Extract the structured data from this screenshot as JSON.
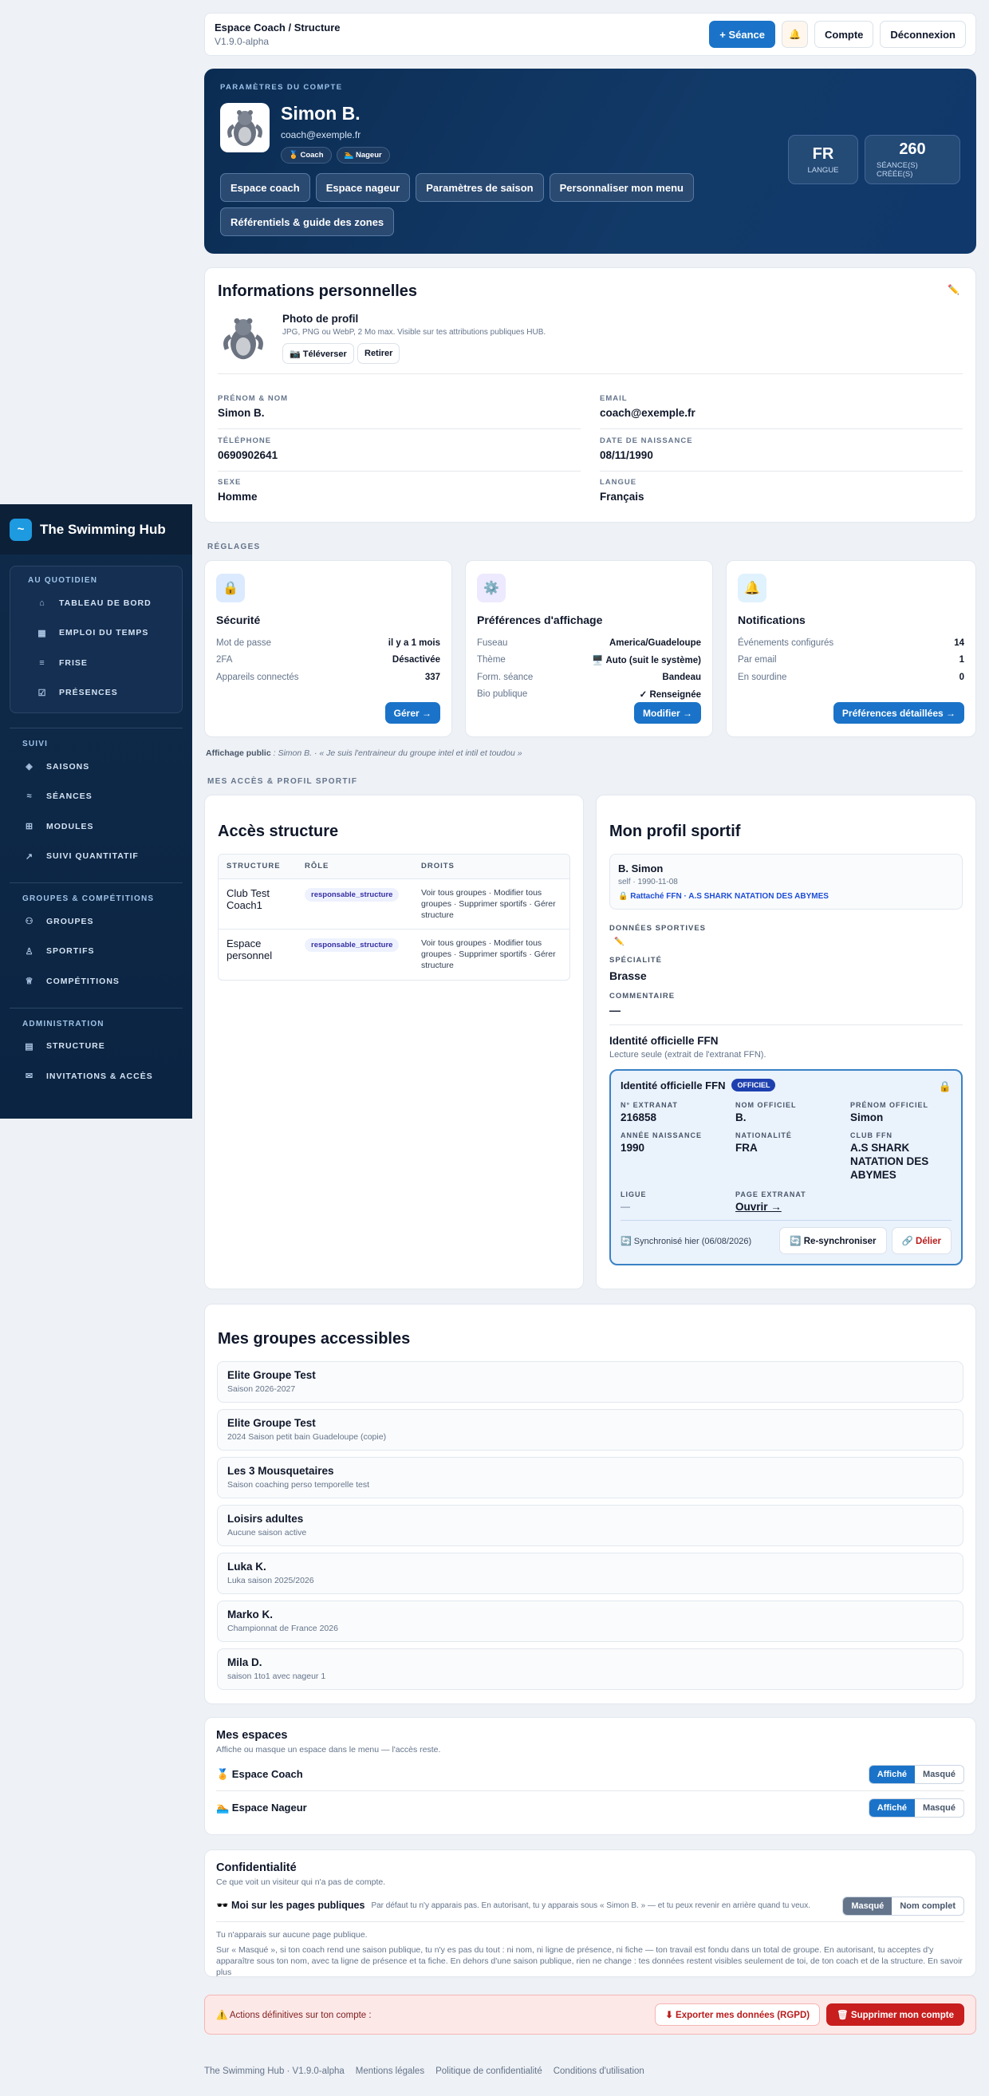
{
  "sidebar": {
    "brand": "The Swimming Hub",
    "daily_section": "AU QUOTIDIEN",
    "daily_items": [
      "TABLEAU DE BORD",
      "EMPLOI DU TEMPS",
      "FRISE",
      "PRÉSENCES"
    ],
    "follow_section": "SUIVI",
    "follow_items": [
      "SAISONS",
      "SÉANCES",
      "MODULES",
      "SUIVI QUANTITATIF"
    ],
    "groups_section": "GROUPES & COMPÉTITIONS",
    "groups_items": [
      "GROUPES",
      "SPORTIFS",
      "COMPÉTITIONS"
    ],
    "admin_section": "ADMINISTRATION",
    "admin_items": [
      "STRUCTURE",
      "INVITATIONS & ACCÈS"
    ]
  },
  "topbar": {
    "title": "Espace Coach / Structure",
    "version": "V1.9.0-alpha",
    "new_session": "+ Séance",
    "bell": "🔔",
    "account": "Compte",
    "logout": "Déconnexion"
  },
  "hero": {
    "kicker": "PARAMÈTRES DU COMPTE",
    "name": "Simon B.",
    "email": "coach@exemple.fr",
    "badge_coach": "🏅 Coach",
    "badge_swimmer": "🏊 Nageur",
    "buttons": [
      "Espace coach",
      "Espace nageur",
      "Paramètres de saison",
      "Personnaliser mon menu",
      "Référentiels & guide des zones"
    ],
    "stat_lang_value": "FR",
    "stat_lang_label": "LANGUE",
    "stat_sessions_value": "260",
    "stat_sessions_label": "SÉANCE(S) CRÉÉE(S)"
  },
  "personal": {
    "title": "Informations personnelles",
    "edit_icon": "✏️",
    "photo_title": "Photo de profil",
    "photo_hint": "JPG, PNG ou WebP, 2 Mo max. Visible sur tes attributions publiques HUB.",
    "upload": "📷 Téléverser",
    "remove": "Retirer",
    "fields": {
      "name_label": "PRÉNOM & NOM",
      "name": "Simon B.",
      "email_label": "EMAIL",
      "email": "coach@exemple.fr",
      "phone_label": "TÉLÉPHONE",
      "phone": "0690902641",
      "birth_label": "DATE DE NAISSANCE",
      "birth": "08/11/1990",
      "sex_label": "SEXE",
      "sex": "Homme",
      "lang_label": "LANGUE",
      "lang": "Français"
    }
  },
  "settings": {
    "section": "RÉGLAGES",
    "security": {
      "icon": "🔒",
      "title": "Sécurité",
      "rows": [
        [
          "Mot de passe",
          "il y a 1 mois"
        ],
        [
          "2FA",
          "Désactivée"
        ],
        [
          "Appareils connectés",
          "337"
        ]
      ],
      "button": "Gérer →"
    },
    "display": {
      "icon": "⚙️",
      "title": "Préférences d'affichage",
      "rows": [
        [
          "Fuseau",
          "America/Guadeloupe"
        ],
        [
          "Thème",
          "🖥️ Auto (suit le système)"
        ],
        [
          "Form. séance",
          "Bandeau"
        ],
        [
          "Bio publique",
          "✓ Renseignée"
        ]
      ],
      "button": "Modifier →"
    },
    "notifications": {
      "icon": "🔔",
      "title": "Notifications",
      "rows": [
        [
          "Événements configurés",
          "14"
        ],
        [
          "Par email",
          "1"
        ],
        [
          "En sourdine",
          "0"
        ]
      ],
      "button": "Préférences détaillées →"
    },
    "public_label": "Affichage public",
    "public_text": " : Simon B. · « Je suis l'entraineur du groupe intel et intil et toudou »"
  },
  "access": {
    "section": "MES ACCÈS & PROFIL SPORTIF",
    "title": "Accès structure",
    "headers": [
      "STRUCTURE",
      "RÔLE",
      "DROITS"
    ],
    "rows": [
      {
        "structure": "Club Test Coach1",
        "role": "responsable_structure",
        "rights": "Voir tous groupes · Modifier tous groupes · Supprimer sportifs · Gérer structure"
      },
      {
        "structure": "Espace personnel",
        "role": "responsable_structure",
        "rights": "Voir tous groupes · Modifier tous groupes · Supprimer sportifs · Gérer structure"
      }
    ]
  },
  "sport": {
    "title": "Mon profil sportif",
    "name": "B. Simon",
    "sub": "self · 1990-11-08",
    "ffn_link": "🔒 Rattaché FFN · A.S SHARK NATATION DES ABYMES",
    "data_label": "DONNÉES SPORTIVES",
    "edit_icon": "✏️",
    "speciality_label": "SPÉCIALITÉ",
    "speciality": "Brasse",
    "comment_label": "COMMENTAIRE",
    "comment": "—",
    "ffn_title": "Identité officielle FFN",
    "ffn_sub": "Lecture seule (extrait de l'extranat FFN).",
    "box": {
      "title": "Identité officielle FFN",
      "badge": "OFFICIEL",
      "lock": "🔒",
      "extranat_label": "N° EXTRANAT",
      "extranat": "216858",
      "lastname_label": "NOM OFFICIEL",
      "lastname": "B.",
      "firstname_label": "PRÉNOM OFFICIEL",
      "firstname": "Simon",
      "year_label": "ANNÉE NAISSANCE",
      "year": "1990",
      "nat_label": "NATIONALITÉ",
      "nat": "FRA",
      "club_label": "CLUB FFN",
      "club": "A.S SHARK NATATION DES ABYMES",
      "league_label": "LIGUE",
      "league": "—",
      "page_label": "PAGE EXTRANAT",
      "page": "Ouvrir →",
      "sync": "🔄 Synchronisé hier (06/08/2026)",
      "resync": "🔄 Re-synchroniser",
      "unlink": "🔗 Délier"
    }
  },
  "groups": {
    "title": "Mes groupes accessibles",
    "items": [
      {
        "name": "Elite Groupe Test",
        "sub": "Saison 2026-2027"
      },
      {
        "name": "Elite Groupe Test",
        "sub": "2024 Saison petit bain Guadeloupe (copie)"
      },
      {
        "name": "Les 3 Mousquetaires",
        "sub": "Saison coaching perso temporelle test"
      },
      {
        "name": "Loisirs adultes",
        "sub": "Aucune saison active"
      },
      {
        "name": "Luka K.",
        "sub": "Luka saison 2025/2026"
      },
      {
        "name": "Marko K.",
        "sub": "Championnat de France 2026"
      },
      {
        "name": "Mila D.",
        "sub": "saison 1to1 avec nageur 1"
      }
    ]
  },
  "spaces": {
    "title": "Mes espaces",
    "sub": "Affiche ou masque un espace dans le menu — l'accès reste.",
    "coach": "🏅 Espace Coach",
    "swimmer": "🏊 Espace Nageur",
    "shown": "Affiché",
    "hidden": "Masqué"
  },
  "privacy": {
    "title": "Confidentialité",
    "sub": "Ce que voit un visiteur qui n'a pas de compte.",
    "row_label": "🕶️ Moi sur les pages publiques",
    "row_desc": "Par défaut tu n'y apparais pas. En autorisant, tu y apparais sous « Simon B. » — et tu peux revenir en arrière quand tu veux.",
    "masked": "Masqué",
    "full": "Nom complet",
    "note1": "Tu n'apparais sur aucune page publique.",
    "note2": "Sur « Masqué », si ton coach rend une saison publique, tu n'y es pas du tout : ni nom, ni ligne de présence, ni fiche — ton travail est fondu dans un total de groupe. En autorisant, tu acceptes d'y apparaître sous ton nom, avec ta ligne de présence et ta fiche. En dehors d'une saison publique, rien ne change : tes données restent visibles seulement de toi, de ton coach et de la structure. En savoir plus"
  },
  "danger": {
    "text": "⚠️ Actions définitives sur ton compte :",
    "export": "⬇ Exporter mes données (RGPD)",
    "delete": "🗑 Supprimer mon compte"
  },
  "footer": [
    "The Swimming Hub · V1.9.0-alpha",
    "Mentions légales",
    "Politique de confidentialité",
    "Conditions d'utilisation"
  ]
}
